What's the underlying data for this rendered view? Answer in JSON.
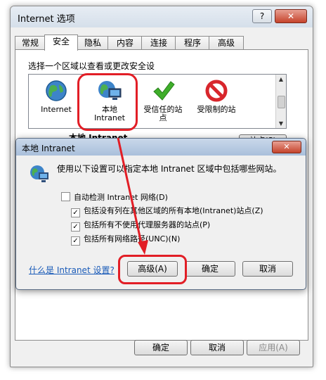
{
  "window": {
    "title": "Internet 选项",
    "help": "?",
    "close": "✕"
  },
  "tabs": [
    "常规",
    "安全",
    "隐私",
    "内容",
    "连接",
    "程序",
    "高级"
  ],
  "security": {
    "prompt": "选择一个区域以查看或更改安全设",
    "zones": [
      {
        "icon": "globe-icon",
        "label": "Internet"
      },
      {
        "icon": "intranet-icon",
        "label": "本地\nIntranet"
      },
      {
        "icon": "checkmark-icon",
        "label": "受信任的站\n点"
      },
      {
        "icon": "prohibited-icon",
        "label": "受限制的站"
      }
    ],
    "heading": "本地 Intranet",
    "sites_button": "站点(S)"
  },
  "bottom": {
    "ok": "确定",
    "cancel": "取消",
    "apply": "应用(A)"
  },
  "dialog": {
    "title": "本地 Intranet",
    "close": "✕",
    "description": "使用以下设置可以指定本地 Intranet 区域中包括哪些网站。",
    "options": [
      {
        "label": "自动检测 Intranet 网络(D)",
        "checked": false
      },
      {
        "label": "包括没有列在其他区域的所有本地(Intranet)站点(Z)",
        "checked": true
      },
      {
        "label": "包括所有不使用代理服务器的站点(P)",
        "checked": true
      },
      {
        "label": "包括所有网络路径(UNC)(N)",
        "checked": true
      }
    ],
    "help_link": "什么是 Intranet 设置?",
    "advanced": "高级(A)",
    "ok": "确定",
    "cancel": "取消"
  },
  "colors": {
    "annotation": "#e21e26",
    "link": "#1a5bb8"
  }
}
